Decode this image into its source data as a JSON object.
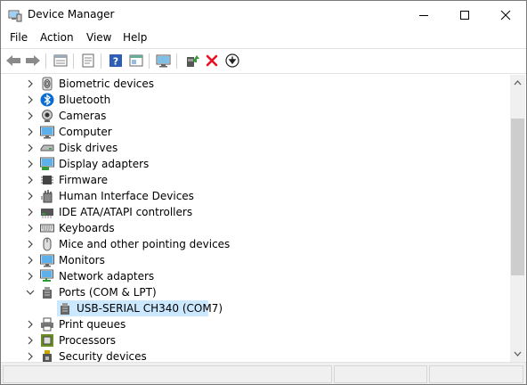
{
  "window": {
    "title": "Device Manager"
  },
  "menu": [
    {
      "label": "File"
    },
    {
      "label": "Action"
    },
    {
      "label": "View"
    },
    {
      "label": "Help"
    }
  ],
  "toolbar": {
    "buttons": [
      "back-icon",
      "forward-icon",
      "properties-list-icon",
      "properties-icon",
      "help-icon",
      "show-hidden-icon",
      "scan-hardware-icon",
      "update-driver-icon",
      "uninstall-icon",
      "disable-icon"
    ]
  },
  "tree": {
    "items": [
      {
        "label": "Biometric devices",
        "expanded": false,
        "icon": "fingerprint-icon"
      },
      {
        "label": "Bluetooth",
        "expanded": false,
        "icon": "bluetooth-icon"
      },
      {
        "label": "Cameras",
        "expanded": false,
        "icon": "camera-icon"
      },
      {
        "label": "Computer",
        "expanded": false,
        "icon": "computer-icon"
      },
      {
        "label": "Disk drives",
        "expanded": false,
        "icon": "disk-drive-icon"
      },
      {
        "label": "Display adapters",
        "expanded": false,
        "icon": "display-adapter-icon"
      },
      {
        "label": "Firmware",
        "expanded": false,
        "icon": "chip-icon"
      },
      {
        "label": "Human Interface Devices",
        "expanded": false,
        "icon": "hid-icon"
      },
      {
        "label": "IDE ATA/ATAPI controllers",
        "expanded": false,
        "icon": "ide-controller-icon"
      },
      {
        "label": "Keyboards",
        "expanded": false,
        "icon": "keyboard-icon"
      },
      {
        "label": "Mice and other pointing devices",
        "expanded": false,
        "icon": "mouse-icon"
      },
      {
        "label": "Monitors",
        "expanded": false,
        "icon": "monitor-icon"
      },
      {
        "label": "Network adapters",
        "expanded": false,
        "icon": "network-adapter-icon"
      },
      {
        "label": "Ports (COM & LPT)",
        "expanded": true,
        "icon": "port-icon"
      },
      {
        "label": "USB-SERIAL CH340 (COM7)",
        "child": true,
        "selected": true,
        "icon": "port-icon"
      },
      {
        "label": "Print queues",
        "expanded": false,
        "icon": "printer-icon"
      },
      {
        "label": "Processors",
        "expanded": false,
        "icon": "processor-icon"
      },
      {
        "label": "Security devices",
        "expanded": false,
        "icon": "security-device-icon"
      }
    ]
  },
  "colors": {
    "selection": "#cce8ff",
    "uninstall_red": "#e81123",
    "accent_blue": "#0078d7"
  }
}
